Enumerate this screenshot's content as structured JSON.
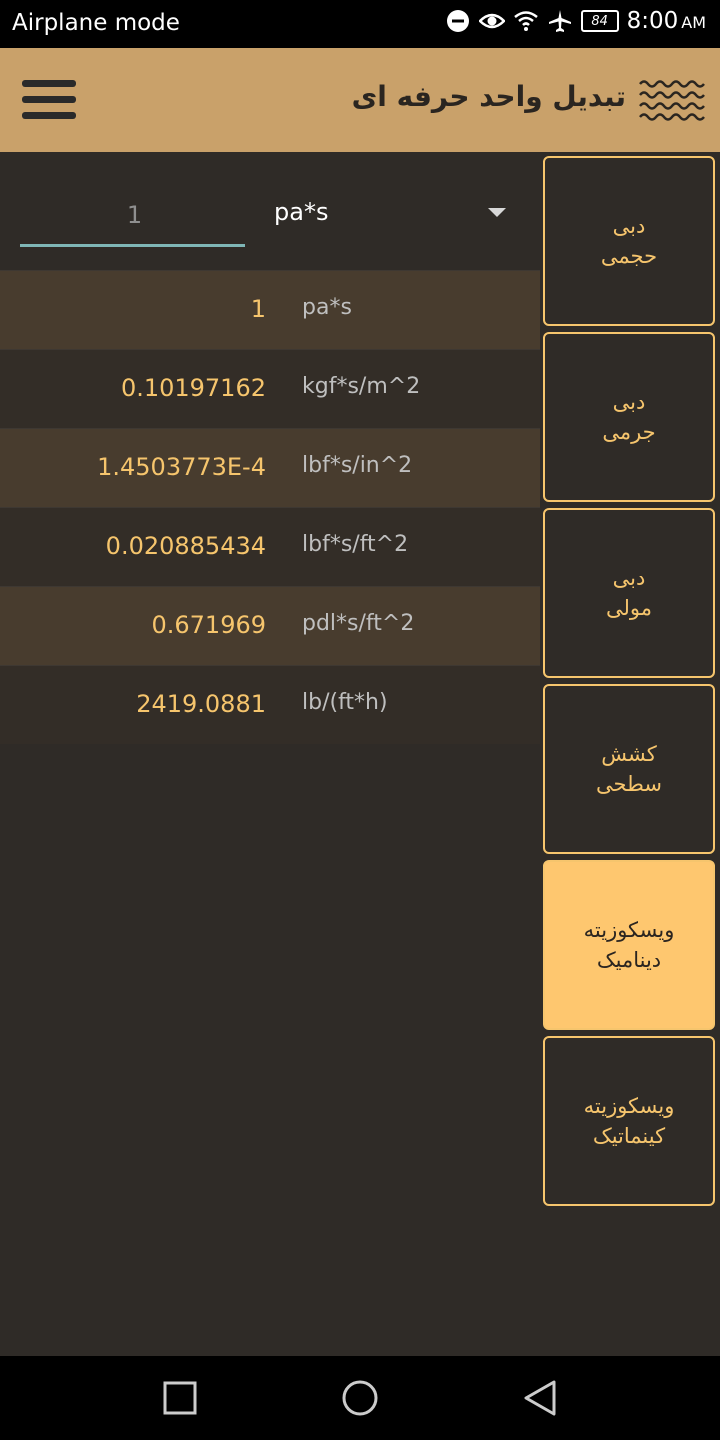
{
  "status_bar": {
    "left_text": "Airplane mode",
    "icons": [
      "dnd-icon",
      "eye-icon",
      "wifi-icon",
      "airplane-icon"
    ],
    "battery": "84",
    "time": "8:00",
    "ampm": "AM"
  },
  "app_bar": {
    "title": "تبدیل واحد حرفه ای",
    "menu_icon": "hamburger-icon",
    "logo_icon": "waves-logo-icon",
    "color": "#c9a16a"
  },
  "converter": {
    "input_value": "1",
    "selected_unit": "pa*s"
  },
  "results": [
    {
      "value": "1",
      "unit": "pa*s"
    },
    {
      "value": "0.10197162",
      "unit": "kgf*s/m^2"
    },
    {
      "value": "1.4503773E-4",
      "unit": "lbf*s/in^2"
    },
    {
      "value": "0.020885434",
      "unit": "lbf*s/ft^2"
    },
    {
      "value": "0.671969",
      "unit": "pdl*s/ft^2"
    },
    {
      "value": "2419.0881",
      "unit": "lb/(ft*h)"
    }
  ],
  "categories": [
    {
      "label": "دبی\nحجمی",
      "active": false
    },
    {
      "label": "دبی\nجرمی",
      "active": false
    },
    {
      "label": "دبی\nمولی",
      "active": false
    },
    {
      "label": "کشش\nسطحی",
      "active": false
    },
    {
      "label": "ویسکوزیته\nدینامیک",
      "active": true
    },
    {
      "label": "ویسکوزیته\nکینماتیک",
      "active": false
    }
  ],
  "colors": {
    "accent": "#f6c56d",
    "active_tab": "#fec76f",
    "background": "#2f2b27",
    "input_underline": "#7fb6b6"
  },
  "nav_bar": {
    "buttons": [
      "recent-apps-icon",
      "home-icon",
      "back-icon"
    ]
  }
}
